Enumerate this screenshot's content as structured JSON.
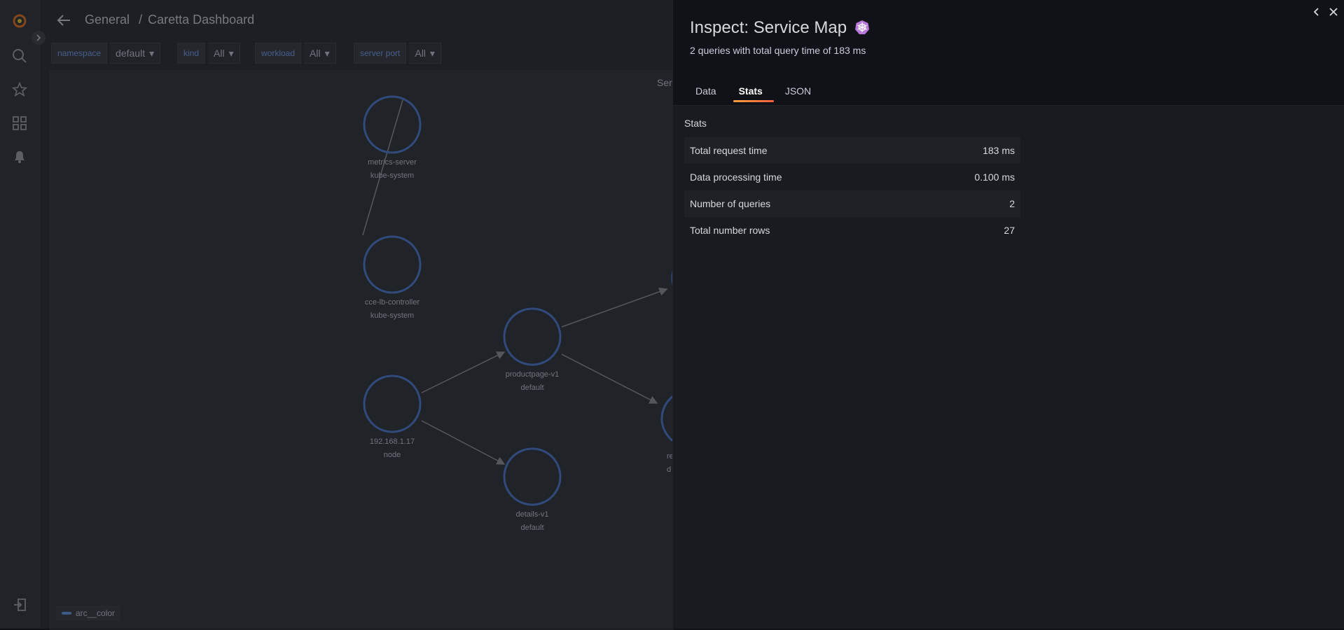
{
  "header": {
    "breadcrumb_folder": "General",
    "breadcrumb_sep": "/",
    "dashboard_title": "Caretta Dashboard"
  },
  "variables": [
    {
      "label": "namespace",
      "value": "default"
    },
    {
      "label": "kind",
      "value": "All"
    },
    {
      "label": "workload",
      "value": "All"
    },
    {
      "label": "server port",
      "value": "All"
    }
  ],
  "panel": {
    "title_fragment": "Ser",
    "nodes": [
      {
        "name": "metrics-server",
        "ns": "kube-system"
      },
      {
        "name": "cce-lb-controller",
        "ns": "kube-system"
      },
      {
        "name": "productpage-v1",
        "ns": "default"
      },
      {
        "name": "192.168.1.17",
        "ns": "node"
      },
      {
        "name": "details-v1",
        "ns": "default"
      },
      {
        "name": "re",
        "ns": "d"
      }
    ],
    "legend": "arc__color"
  },
  "inspect": {
    "title": "Inspect: Service Map",
    "subtitle": "2 queries with total query time of 183 ms",
    "tabs": [
      "Data",
      "Stats",
      "JSON"
    ],
    "active_tab": "Stats",
    "stats_heading": "Stats",
    "stats": [
      {
        "label": "Total request time",
        "value": "183 ms"
      },
      {
        "label": "Data processing time",
        "value": "0.100 ms"
      },
      {
        "label": "Number of queries",
        "value": "2"
      },
      {
        "label": "Total number rows",
        "value": "27"
      }
    ]
  },
  "colors": {
    "accent": "#f55f3e",
    "node_ring": "#3d71d9",
    "link_blue": "#6e9fff"
  }
}
